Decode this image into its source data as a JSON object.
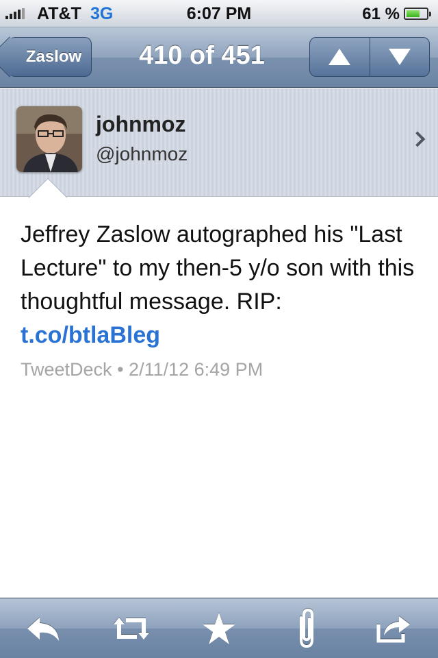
{
  "status_bar": {
    "carrier": "AT&T",
    "network": "3G",
    "time": "6:07 PM",
    "battery": "61 %",
    "battery_level": 0.61
  },
  "nav": {
    "back_label": "Zaslow",
    "title": "410 of 451",
    "prev_icon": "triangle-up-icon",
    "next_icon": "triangle-down-icon"
  },
  "profile": {
    "name": "johnmoz",
    "handle": "@johnmoz"
  },
  "tweet": {
    "text": "Jeffrey Zaslow autographed his \"Last Lecture\" to my then-5 y/o son with this thoughtful message. RIP: ",
    "link": "t.co/btlaBleg",
    "source": "TweetDeck",
    "separator": "•",
    "timestamp": "2/11/12 6:49 PM"
  },
  "toolbar": {
    "items": [
      "reply-icon",
      "retweet-icon",
      "favorite-star-icon",
      "attach-paperclip-icon",
      "share-icon"
    ]
  },
  "colors": {
    "link": "#2a73d4",
    "nav_bar": "#7a91ae",
    "network": "#1f74d6"
  }
}
